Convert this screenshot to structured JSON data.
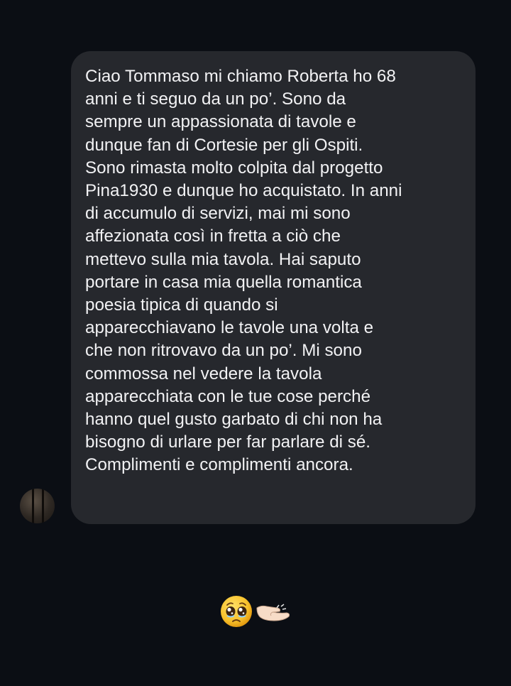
{
  "conversation": {
    "message": {
      "text": "Ciao Tommaso mi chiamo Roberta ho 68\nanni e ti seguo da un po’. Sono da\nsempre un appassionata di tavole e\ndunque fan di Cortesie per gli Ospiti.\nSono rimasta molto colpita dal progetto\nPina1930 e dunque ho acquistato. In anni\ndi accumulo di servizi, mai mi sono\naffezionata così in fretta a ciò che\nmettevo sulla mia tavola. Hai saputo\nportare in casa mia quella romantica\npoesia tipica di quando si\napparecchiavano le tavole una volta e\nche non ritrovavo da un po’. Mi sono\ncommossa nel vedere la tavola\napparecchiata con le tue cose perché\nhanno quel gusto garbato di chi non ha\nbisogno di urlare per far parlare di sé.\nComplimenti e complimenti ancora."
    },
    "reaction": {
      "icons": [
        "pleading-face-icon",
        "pinching-hand-icon"
      ]
    }
  },
  "colors": {
    "background": "#0b0e14",
    "bubble": "#26282d",
    "text": "#f2f2f4"
  }
}
